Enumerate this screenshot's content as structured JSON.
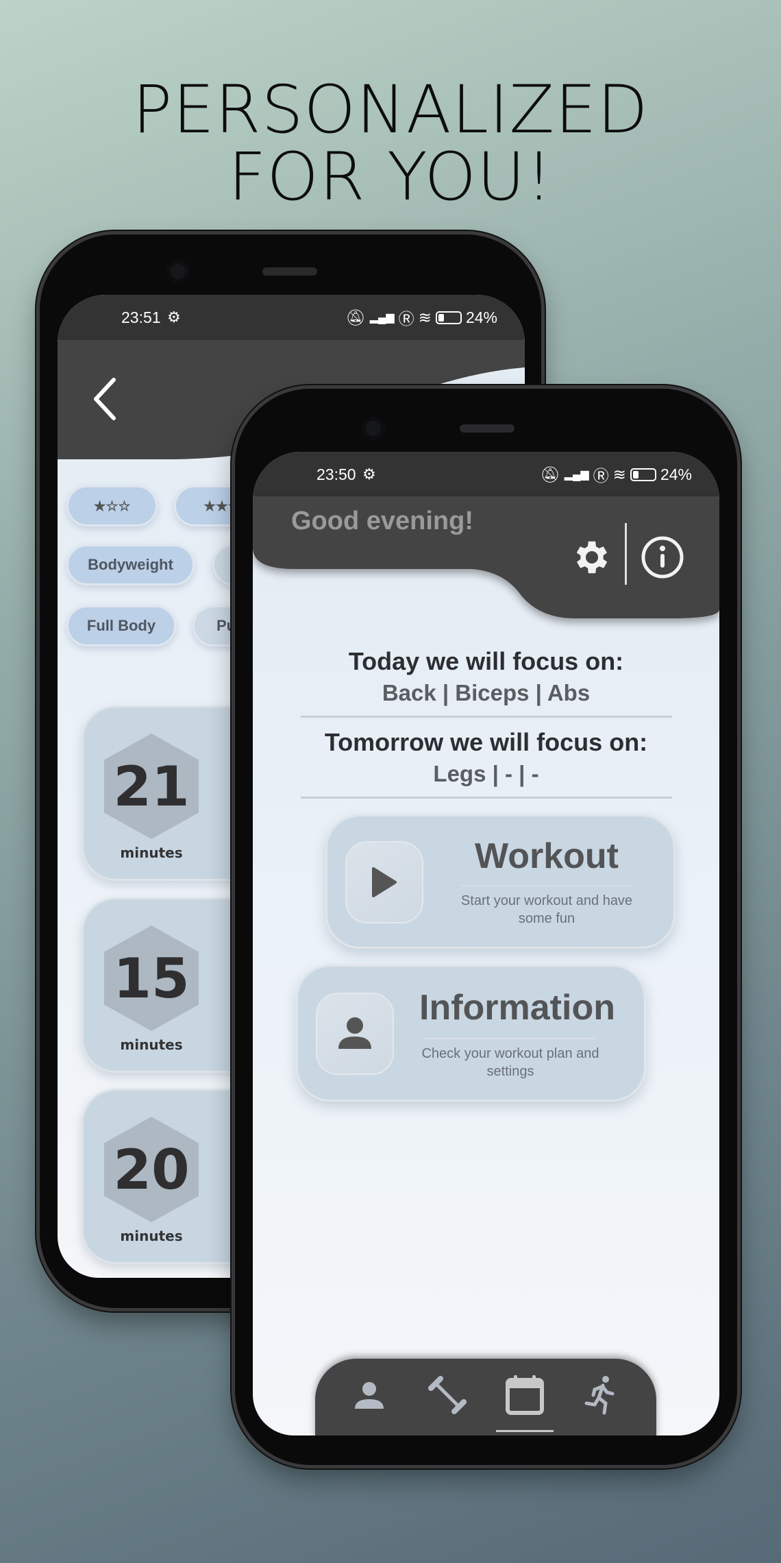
{
  "headline": {
    "line1": "PERSONALIZED",
    "line2": "FOR YOU!"
  },
  "back_phone": {
    "status_bar": {
      "time": "23:51",
      "battery": "24%",
      "icons": [
        "settings-icon",
        "bell-off-icon",
        "volte-icon",
        "5g-signal-icon",
        "roaming-icon",
        "signal-icon",
        "wifi-icon",
        "battery-icon"
      ]
    },
    "header": {
      "back_icon": "chevron-left-icon"
    },
    "chips": {
      "row1": [
        {
          "label": "★☆☆"
        },
        {
          "label": "★★☆"
        }
      ],
      "row2": [
        {
          "label": "Bodyweight"
        },
        {
          "label": ""
        }
      ],
      "row3": [
        {
          "label": "Full Body"
        },
        {
          "label": "Pu"
        }
      ]
    },
    "workouts": [
      {
        "minutes": "21",
        "unit": "minutes"
      },
      {
        "minutes": "15",
        "unit": "minutes"
      },
      {
        "minutes": "20",
        "unit": "minutes"
      }
    ]
  },
  "front_phone": {
    "status_bar": {
      "time": "23:50",
      "battery": "24%"
    },
    "header": {
      "greeting": "Good evening!",
      "settings_icon": "gear-icon",
      "info_icon": "info-icon"
    },
    "today": {
      "heading": "Today we will focus on:",
      "value": "Back | Biceps | Abs"
    },
    "tomorrow": {
      "heading": "Tomorrow we will focus on:",
      "value": "Legs | - | -"
    },
    "cards": [
      {
        "title": "Workout",
        "subtitle": "Start your workout and have some fun",
        "icon": "play-icon"
      },
      {
        "title": "Information",
        "subtitle": "Check your workout plan and settings",
        "icon": "person-icon"
      }
    ],
    "bottom_nav": {
      "items": [
        {
          "icon": "person-icon",
          "active": false
        },
        {
          "icon": "dumbbell-icon",
          "active": false
        },
        {
          "icon": "calendar-icon",
          "active": true
        },
        {
          "icon": "running-icon",
          "active": false
        }
      ]
    }
  },
  "colors": {
    "header": "#444444",
    "status_bar": "#333333",
    "chip": "#bcd0e8",
    "card": "#c9d7e3",
    "nav_icon": "#b4bac4",
    "nav_active": "#c8c8c8"
  }
}
